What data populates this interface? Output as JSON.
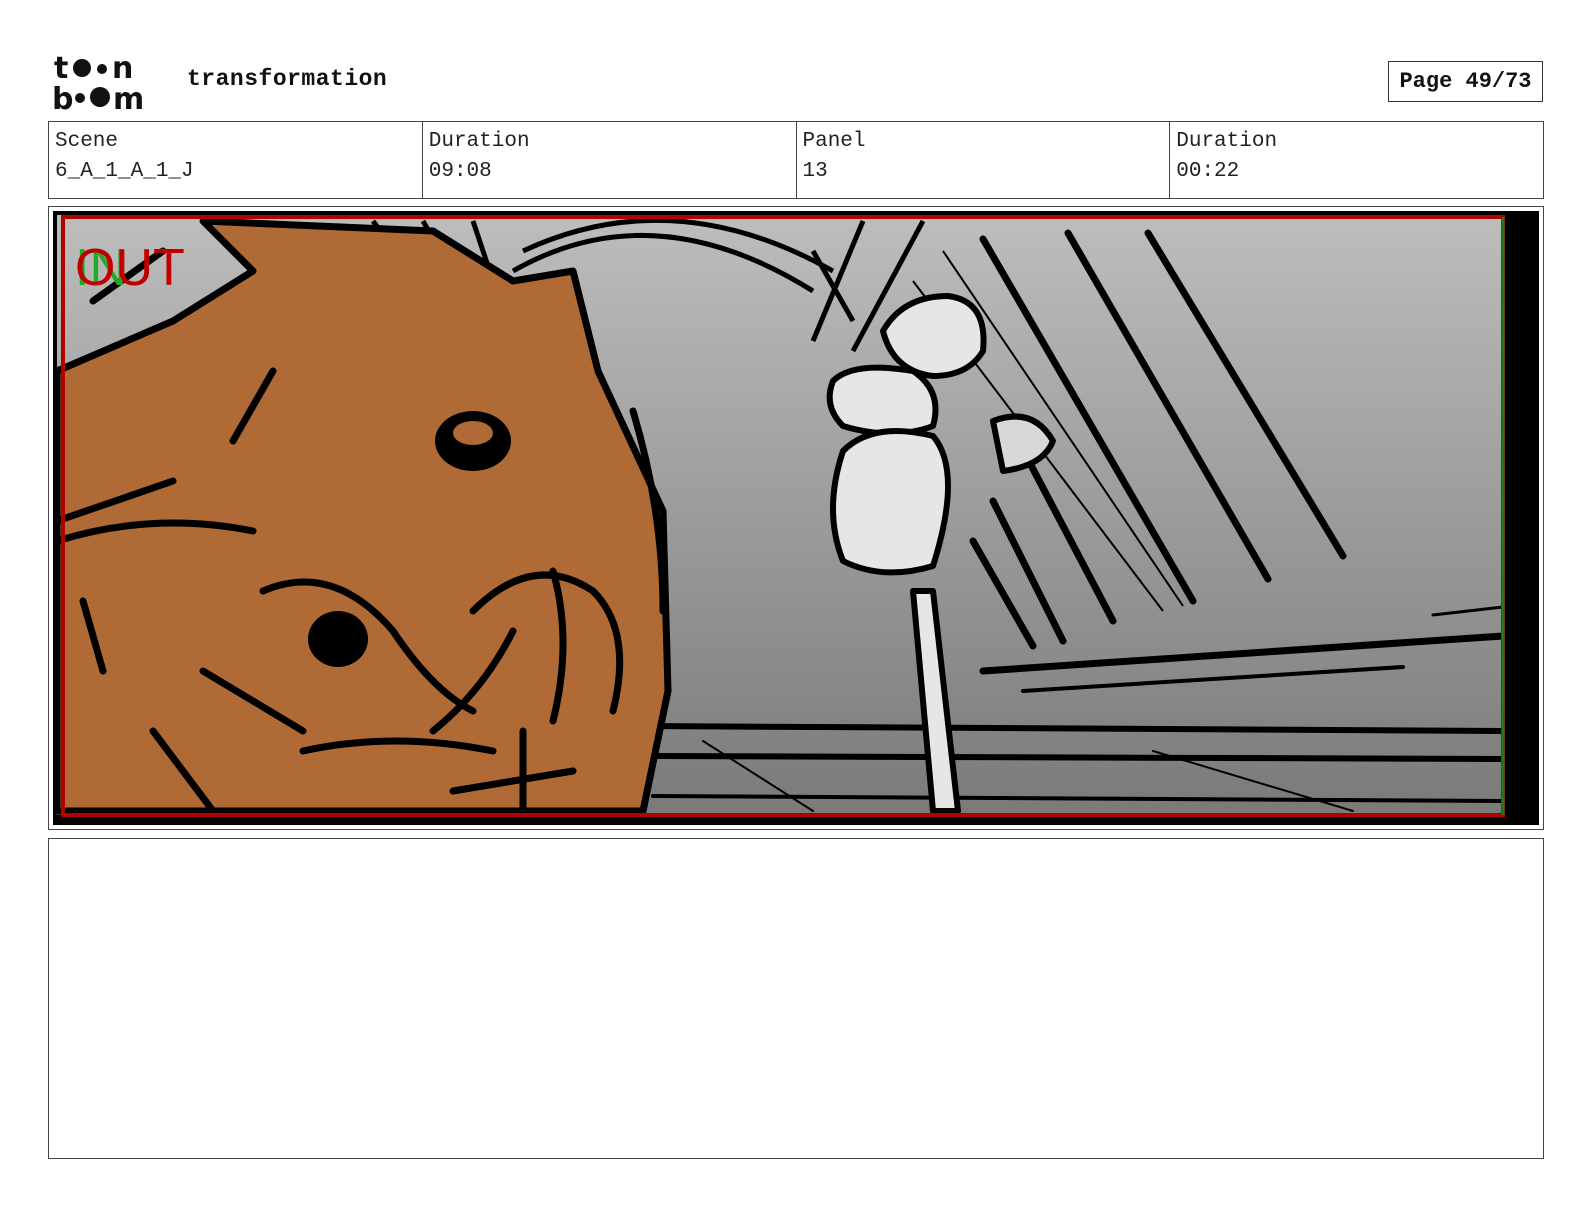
{
  "header": {
    "logo_line1": "toon",
    "logo_line2": "boom",
    "project_title": "transformation",
    "page_label": "Page 49/73"
  },
  "info": {
    "scene_label": "Scene",
    "scene_value": "6_A_1_A_1_J",
    "scene_duration_label": "Duration",
    "scene_duration_value": "09:08",
    "panel_label": "Panel",
    "panel_value": "13",
    "panel_duration_label": "Duration",
    "panel_duration_value": "00:22"
  },
  "panel": {
    "in_marker": "IN",
    "out_marker": "OUT",
    "in_color": "#22aa22",
    "out_color": "#c00000",
    "safe_frame_color": "#b00000",
    "character_color": "#b06a35"
  },
  "notes": {
    "text": ""
  }
}
